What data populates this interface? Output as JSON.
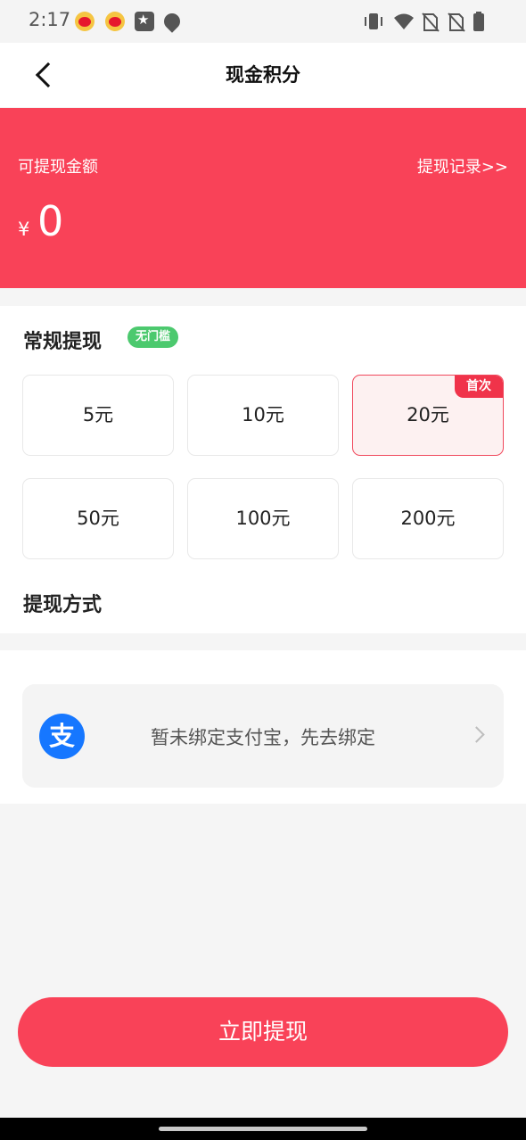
{
  "status_bar": {
    "time": "2:17",
    "icons": [
      "weibo-icon",
      "weibo-icon",
      "star-icon",
      "location-icon",
      "vibrate-icon",
      "wifi-icon",
      "no-sim-icon",
      "no-sim-icon",
      "battery-icon"
    ]
  },
  "header": {
    "title": "现金积分",
    "back_icon": "chevron-left-icon"
  },
  "balance": {
    "label": "可提现金额",
    "record_link": "提现记录>>",
    "currency": "¥",
    "amount": "0",
    "background_color": "#f94258"
  },
  "regular": {
    "title": "常规提现",
    "badge": "无门槛",
    "badge_color": "#4cc96e",
    "options": [
      {
        "label": "5元",
        "selected": false
      },
      {
        "label": "10元",
        "selected": false
      },
      {
        "label": "20元",
        "selected": true,
        "tag": "首次"
      },
      {
        "label": "50元",
        "selected": false
      },
      {
        "label": "100元",
        "selected": false
      },
      {
        "label": "200元",
        "selected": false
      }
    ]
  },
  "method": {
    "title": "提现方式",
    "alipay_icon": "alipay-icon",
    "alipay_glyph": "支",
    "alipay_text": "暂未绑定支付宝，先去绑定"
  },
  "action": {
    "withdraw_label": "立即提现",
    "accent_color": "#f94258"
  }
}
